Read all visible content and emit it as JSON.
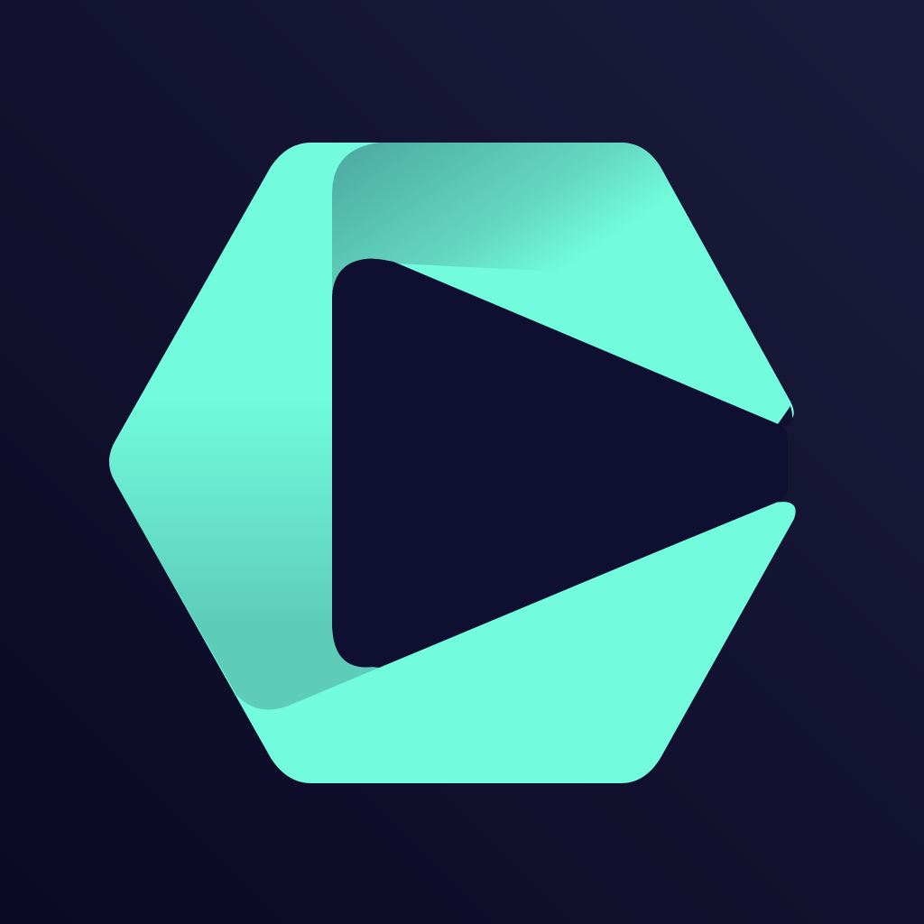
{
  "app_icon": {
    "name": "hexagon-play-logo-icon",
    "colors": {
      "background_light": "#1b1b3b",
      "background_dark": "#0a0a26",
      "accent": "#72fbdc",
      "accent_shadow": "#4ca79f",
      "cutout": "#0f0f31"
    }
  }
}
